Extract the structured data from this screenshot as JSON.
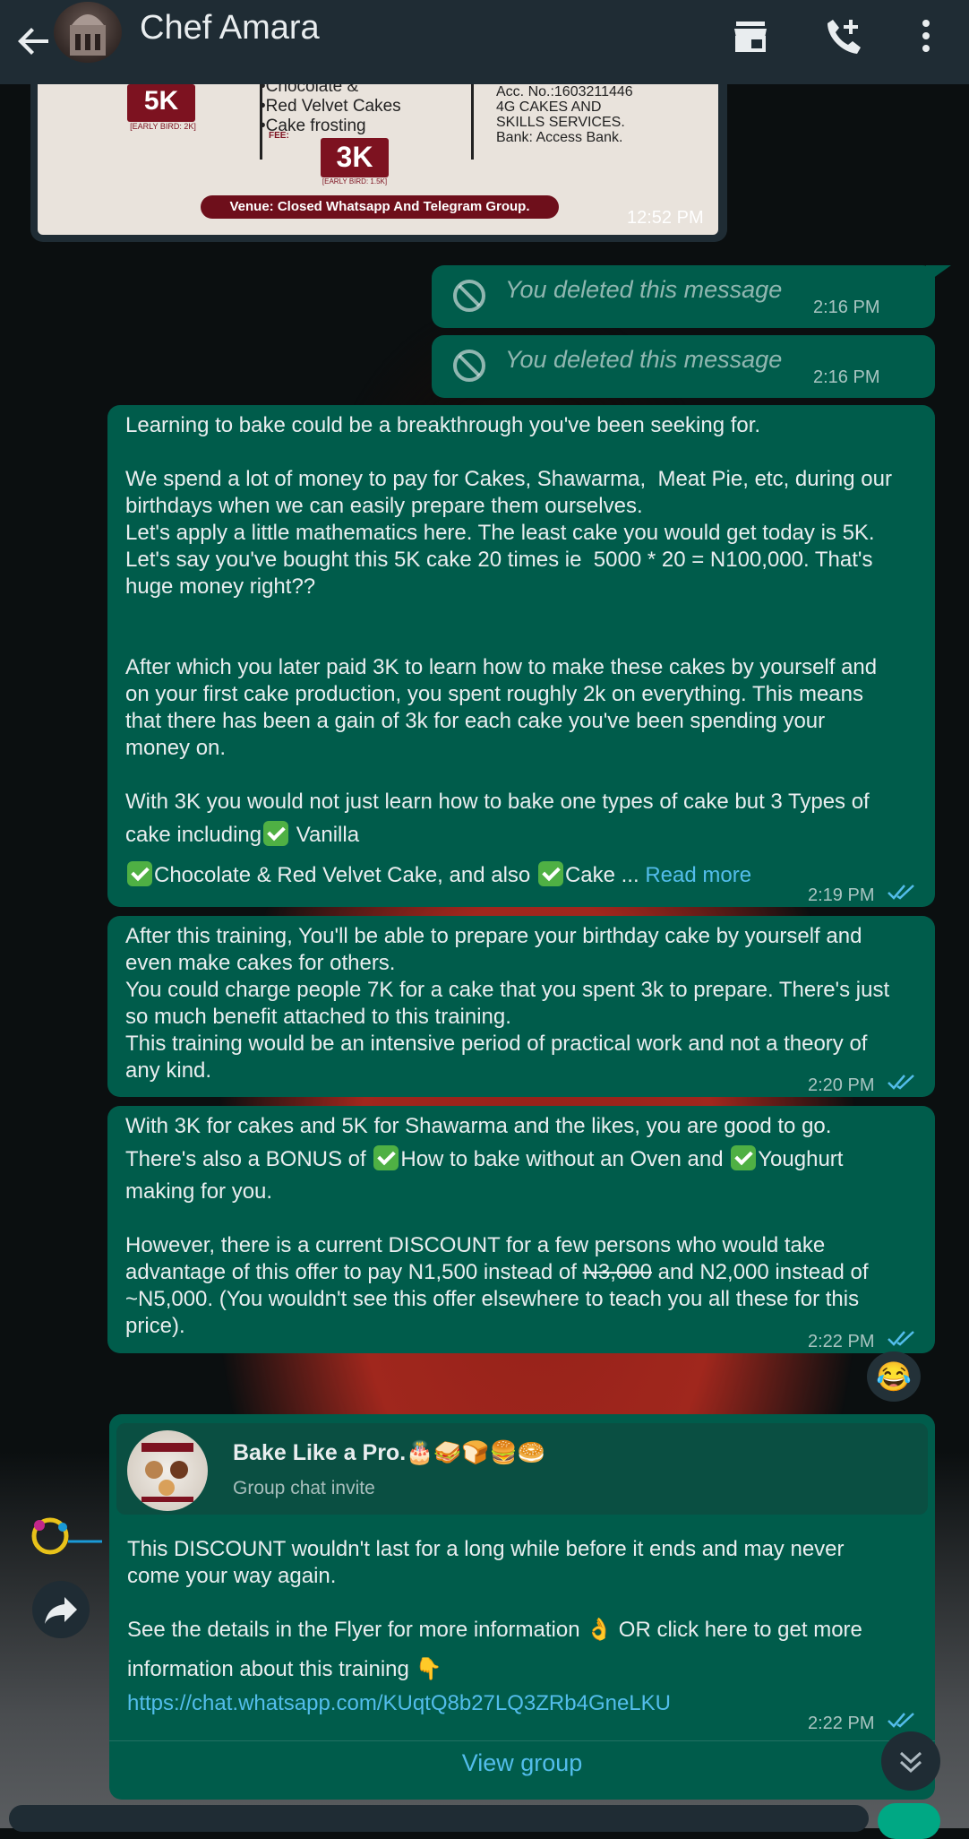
{
  "header": {
    "title": "Chef Amara"
  },
  "flyer": {
    "fee_left": "5K",
    "fee_left_note": "[EARLY BIRD: 2K]",
    "fee_mid": "3K",
    "fee_mid_note": "[EARLY BIRD: 1.5K]",
    "fee_label": "FEE:",
    "list_items": [
      "•Chocolate &",
      "•Red Velvet Cakes",
      "•Cake frosting"
    ],
    "account": [
      "Acc. No.:1603211446",
      "4G CAKES AND",
      "SKILLS SERVICES.",
      "Bank: Access Bank."
    ],
    "venue": "Venue: Closed Whatsapp And Telegram Group.",
    "time": "12:52 PM"
  },
  "deleted_messages": [
    {
      "text": "You deleted this message",
      "time": "2:16 PM"
    },
    {
      "text": "You deleted this message",
      "time": "2:16 PM"
    }
  ],
  "msg1": {
    "p1": "Learning to bake could be a breakthrough you've been seeking for.",
    "p2": "We spend a lot of money to pay for Cakes, Shawarma,  Meat Pie, etc, during our\nbirthdays when we can easily prepare them ourselves.\nLet's apply a little mathematics here. The least cake you would get today is 5K.\nLet's say you've bought this 5K cake 20 times ie  5000 * 20 = N100,000. That's\nhuge money right??",
    "p3": "After which you later paid 3K to learn how to make these cakes by yourself and\non your first cake production, you spent roughly 2k on everything. This means\nthat there has been a gain of 3k for each cake you've been spending your\nmoney on.",
    "p4a": "With 3K you would not just learn how to bake one types of cake but 3 Types of",
    "p4b": "cake including",
    "p4c": " Vanilla",
    "p5a": "Chocolate & Red Velvet Cake, and also ",
    "p5b": "Cake ... ",
    "read_more": "Read more",
    "time": "2:19 PM"
  },
  "msg2": {
    "text": "After this training, You'll be able to prepare your birthday cake by yourself and\neven make cakes for others.\nYou could charge people 7K for a cake that you spent 3k to prepare. There's just\nso much benefit attached to this training.\nThis training would be an intensive period of practical work and not a theory of\nany kind.",
    "time": "2:20 PM"
  },
  "msg3": {
    "l1": "With 3K for cakes and 5K for Shawarma and the likes, you are good to go.",
    "l2a": "There's also a BONUS of ",
    "l2b": "How to bake without an Oven and ",
    "l2c": "Youghurt",
    "l3": "making for you.",
    "p2a": "However, there is a current DISCOUNT for a few persons who would take\nadvantage of this offer to pay N1,500 instead of ",
    "p2strike": "N3,000",
    "p2b": " and N2,000 instead of\n~N5,000. (You wouldn't see this offer elsewhere to teach you all these for this\nprice).",
    "time": "2:22 PM",
    "reaction": "😂"
  },
  "msg4": {
    "group_name": "Bake Like a Pro.🎂🥪🍞🍔🥯",
    "group_sub": "Group chat invite",
    "p1": "This DISCOUNT wouldn't last for a long while before it ends and may never\ncome your way again.",
    "p2a": "See the details in the Flyer for more information 👌 OR click here to get more",
    "p2b": "information about this training 👇",
    "link": "https://chat.whatsapp.com/KUqtQ8b27LQ3ZRb4GneLKU",
    "time": "2:22 PM",
    "view_group": "View group"
  },
  "colors": {
    "bubble_out": "#005c4b",
    "header_bg": "#1f2c34",
    "link": "#53bdeb",
    "read_ticks": "#53bdeb"
  }
}
